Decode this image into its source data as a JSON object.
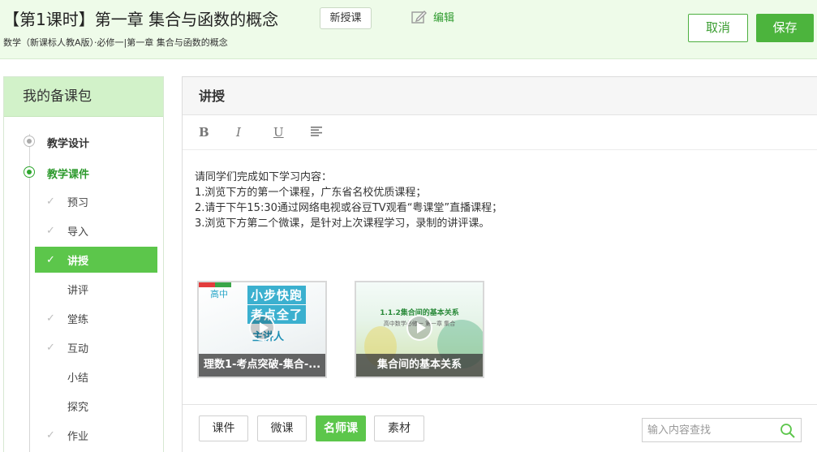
{
  "header": {
    "title": "【第1课时】第一章 集合与函数的概念",
    "badge": "新授课",
    "edit_label": "编辑",
    "subtitle": "数学（新课标人教A版）·必修一|第一章 集合与函数的概念",
    "cancel_label": "取消",
    "save_label": "保存",
    "accent_color": "#4cb43d"
  },
  "sidebar": {
    "title": "我的备课包",
    "sections": [
      {
        "label": "教学设计",
        "active": false
      },
      {
        "label": "教学课件",
        "active": true
      }
    ],
    "items": [
      {
        "label": "预习",
        "checked": true,
        "active": false
      },
      {
        "label": "导入",
        "checked": true,
        "active": false
      },
      {
        "label": "讲授",
        "checked": true,
        "active": true
      },
      {
        "label": "讲评",
        "checked": false,
        "active": false
      },
      {
        "label": "堂练",
        "checked": true,
        "active": false
      },
      {
        "label": "互动",
        "checked": true,
        "active": false
      },
      {
        "label": "小结",
        "checked": false,
        "active": false
      },
      {
        "label": "探究",
        "checked": false,
        "active": false
      },
      {
        "label": "作业",
        "checked": true,
        "active": false
      }
    ]
  },
  "main": {
    "title": "讲授",
    "toolbar": [
      "B",
      "I",
      "U",
      "align-left-icon"
    ],
    "content_lines": [
      "请同学们完成如下学习内容：",
      "1.浏览下方的第一个课程，广东省名校优质课程；",
      "2.请于下午15:30通过网络电视或谷豆TV观看“粤课堂”直播课程；",
      "3.浏览下方第二个微课，是针对上次课程学习，录制的讲评课。"
    ],
    "videos": [
      {
        "caption": "理数1-考点突破-集合-...",
        "thumb_lines": [
          "高中",
          "小步快跑",
          "考点全了",
          "主讲人"
        ]
      },
      {
        "caption": "集合间的基本关系",
        "thumb_lines": [
          "1.1.2集合间的基本关系",
          "高中数学必修一 第一章 集合"
        ]
      }
    ],
    "tabs": [
      {
        "label": "课件",
        "active": false
      },
      {
        "label": "微课",
        "active": false
      },
      {
        "label": "名师课",
        "active": true
      },
      {
        "label": "素材",
        "active": false
      }
    ],
    "search": {
      "placeholder": "输入内容查找",
      "value": ""
    }
  }
}
